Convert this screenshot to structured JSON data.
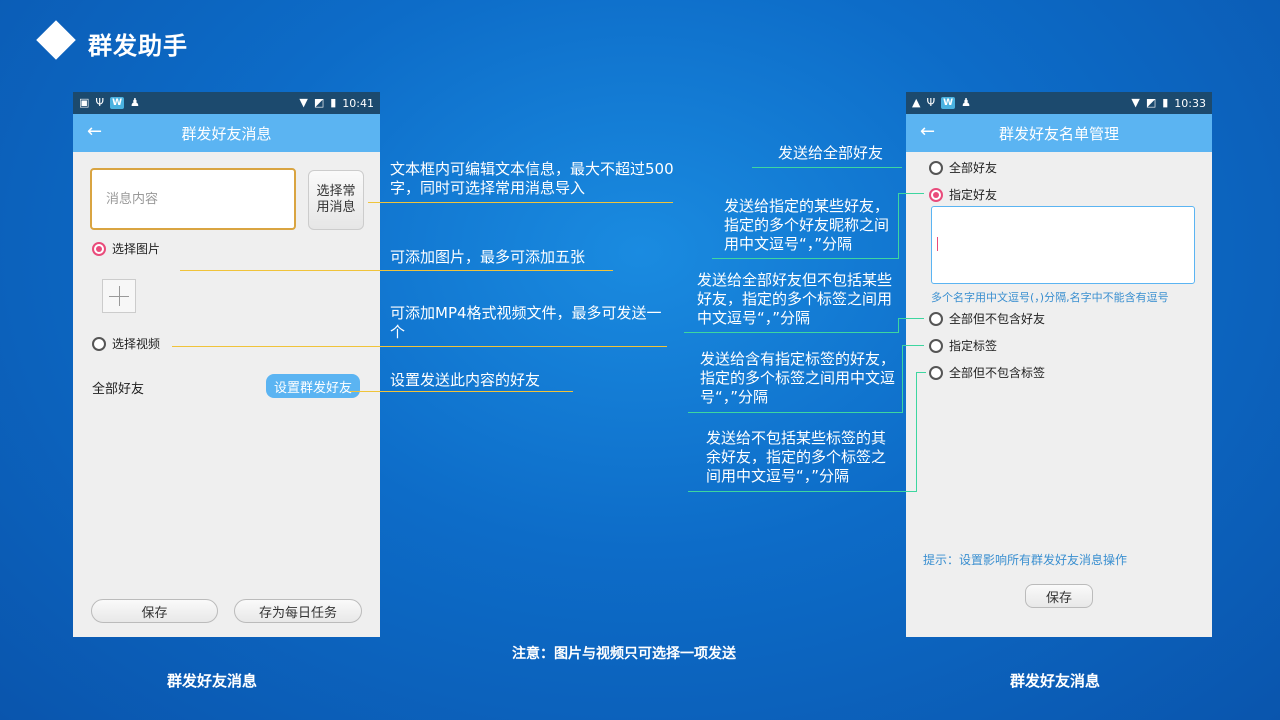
{
  "header": {
    "title": "群发助手"
  },
  "left_phone": {
    "status": {
      "time": "10:41"
    },
    "appbar": {
      "back": "←",
      "title": "群发好友消息"
    },
    "message_placeholder": "消息内容",
    "choose_common_label": "选择常用消息",
    "radio_image_label": "选择图片",
    "radio_video_label": "选择视频",
    "all_friends_label": "全部好友",
    "set_friends_button": "设置群发好友",
    "save_button": "保存",
    "save_daily_button": "存为每日任务"
  },
  "right_phone": {
    "status": {
      "time": "10:33"
    },
    "appbar": {
      "back": "←",
      "title": "群发好友名单管理"
    },
    "options": [
      "全部好友",
      "指定好友",
      "全部但不包含好友",
      "指定标签",
      "全部但不包含标签"
    ],
    "selected_option": "指定好友",
    "names_hint": "多个名字用中文逗号(，)分隔,名字中不能含有逗号",
    "tip": "提示：设置影响所有群发好友消息操作",
    "save_button": "保存"
  },
  "annotations_left": [
    "文本框内可编辑文本信息，最大不超过500字，同时可选择常用消息导入",
    "可添加图片，最多可添加五张",
    "可添加MP4格式视频文件，最多可发送一个",
    "设置发送此内容的好友"
  ],
  "annotations_right": [
    "发送给全部好友",
    "发送给指定的某些好友，指定的多个好友昵称之间用中文逗号“，”分隔",
    "发送给全部好友但不包括某些好友，指定的多个标签之间用中文逗号“，”分隔",
    "发送给含有指定标签的好友，指定的多个标签之间用中文逗号“，”分隔",
    "发送给不包括某些标签的其余好友，指定的多个标签之间用中文逗号“，”分隔"
  ],
  "captions": {
    "left": "群发好友消息",
    "right": "群发好友消息",
    "notice": "注意：图片与视频只可选择一项发送"
  },
  "colors": {
    "accent": "#5bb4f2",
    "radio_selected": "#e94b7b",
    "annot_line_yellow": "#f0c33a",
    "annot_line_green": "#3dd6a0"
  }
}
